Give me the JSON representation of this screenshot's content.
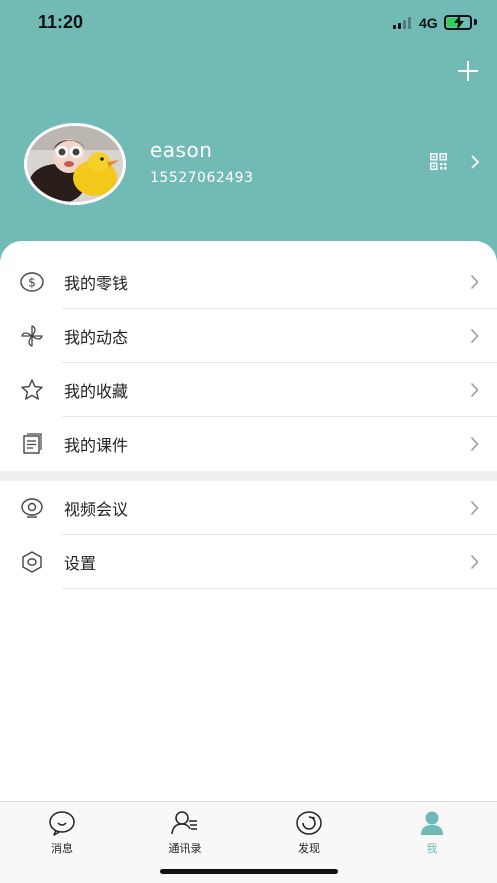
{
  "status_bar": {
    "time": "11:20",
    "network": "4G"
  },
  "colors": {
    "header": "#72bab6",
    "accent": "#6fbab6",
    "battery": "#2ed158"
  },
  "profile": {
    "name": "eason",
    "phone": "15527062493"
  },
  "menu": {
    "group1": [
      {
        "label": "我的零钱",
        "icon": "wallet-icon"
      },
      {
        "label": "我的动态",
        "icon": "pinwheel-icon"
      },
      {
        "label": "我的收藏",
        "icon": "star-icon"
      },
      {
        "label": "我的课件",
        "icon": "document-icon"
      }
    ],
    "group2": [
      {
        "label": "视频会议",
        "icon": "webcam-icon"
      },
      {
        "label": "设置",
        "icon": "hexagon-settings-icon"
      }
    ]
  },
  "tabbar": {
    "tabs": [
      {
        "label": "消息",
        "icon": "chat-icon"
      },
      {
        "label": "通讯录",
        "icon": "contacts-icon"
      },
      {
        "label": "发现",
        "icon": "discover-icon"
      },
      {
        "label": "我",
        "icon": "user-icon",
        "active": true
      }
    ]
  }
}
